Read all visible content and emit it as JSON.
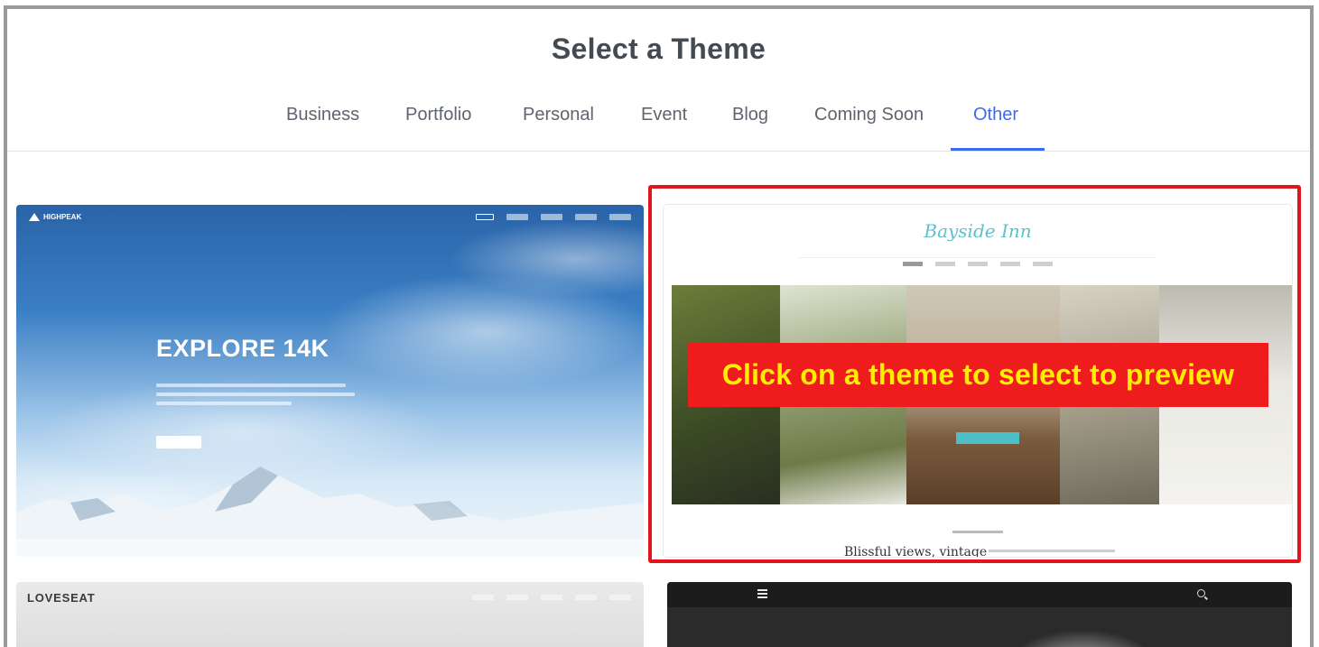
{
  "header": {
    "title": "Select a Theme"
  },
  "tabs": [
    {
      "label": "Business",
      "active": false
    },
    {
      "label": "Portfolio",
      "active": false
    },
    {
      "label": "Personal",
      "active": false
    },
    {
      "label": "Event",
      "active": false
    },
    {
      "label": "Blog",
      "active": false
    },
    {
      "label": "Coming Soon",
      "active": false
    },
    {
      "label": "Other",
      "active": true
    }
  ],
  "colors": {
    "accent": "#3d6af2",
    "highlight_border": "#e3141b",
    "callout_bg": "#ee1c1c",
    "callout_text": "#ffee00"
  },
  "themes": [
    {
      "name": "highpeak",
      "logo": "HIGHPEAK",
      "headline": "EXPLORE 14K"
    },
    {
      "name": "bayside-inn",
      "logo": "Bayside Inn",
      "heading": "Blissful views, vintage",
      "selected": true
    },
    {
      "name": "loveseat",
      "logo": "LOVESEAT"
    },
    {
      "name": "dark-theme",
      "icons": [
        "hamburger-menu-icon",
        "search-icon"
      ]
    }
  ],
  "callout": {
    "text": "Click on a theme to select to preview"
  }
}
